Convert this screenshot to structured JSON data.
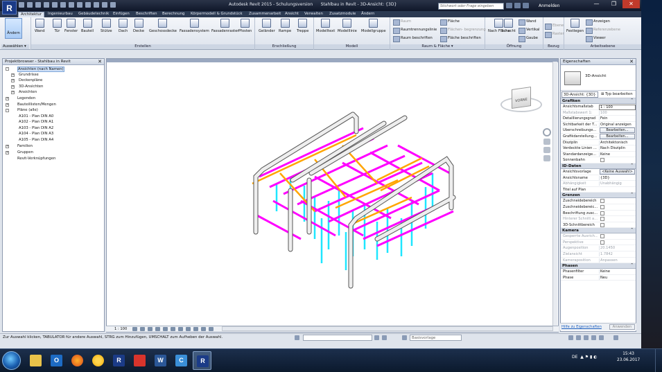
{
  "window": {
    "app_title": "Autodesk Revit 2015 - Schulungsversion",
    "doc_title": "Stahlbau in Revit - 3D-Ansicht: {3D}",
    "search_placeholder": "Stichwort oder Frage eingeben",
    "login": "Anmelden",
    "min": "—",
    "max": "❐",
    "close": "✕"
  },
  "tabs": [
    "Architektur",
    "Ingenieurbau",
    "Gebäudetechnik",
    "Einfügen",
    "Beschriften",
    "Berechnung",
    "Körpermodell & Grundstück",
    "Zusammenarbeit",
    "Ansicht",
    "Verwalten",
    "Zusatzmodule",
    "Ändern"
  ],
  "ribbon": {
    "select": {
      "button": "Ändern",
      "label": "Auswählen ▾"
    },
    "erstellen": {
      "label": "Erstellen",
      "buttons": [
        "Wand",
        "Tür",
        "Fenster",
        "Bauteil",
        "Stütze",
        "Dach",
        "Decke",
        "Geschossdecke",
        "Fassadensystem",
        "Fassadenraster",
        "Pfosten"
      ]
    },
    "erschliessung": {
      "label": "Erschließung",
      "buttons": [
        "Geländer",
        "Rampe",
        "Treppe"
      ]
    },
    "modell": {
      "label": "Modell",
      "buttons": [
        "Modelltext",
        "Modelllinie",
        "Modellgruppe"
      ]
    },
    "raum": {
      "label": "Raum & Fläche ▾",
      "items": [
        "Raum",
        "Raumtrennungslinie",
        "Raum beschriften",
        "Fläche",
        "Flächen- begrenzung",
        "Fläche beschriften"
      ]
    },
    "oeffnung": {
      "label": "Öffnung",
      "buttons": [
        "Nach Fläche",
        "Schacht"
      ],
      "small": [
        "Wand",
        "Vertikal",
        "Gaube"
      ]
    },
    "bezug": {
      "label": "Bezug",
      "small": [
        "Ebene",
        "Raster"
      ]
    },
    "arbeitsebene": {
      "label": "Arbeitsebene",
      "button": "Festlegen",
      "small": [
        "Anzeigen",
        "Referenzebene",
        "Viewer"
      ]
    }
  },
  "browser": {
    "title": "Projektbrowser - Stahlbau in Revit",
    "close": "✕",
    "root": "Ansichten (nach Namen)",
    "views": [
      "Grundrisse",
      "Deckenpläne",
      "3D-Ansichten",
      "Ansichten"
    ],
    "legends": "Legenden",
    "schedules": "Bauteillisten/Mengen",
    "sheets_root": "Pläne (alle)",
    "sheets": [
      "A101 - Plan DIN A0",
      "A102 - Plan DIN A1",
      "A103 - Plan DIN A2",
      "A104 - Plan DIN A3",
      "A105 - Plan DIN A4"
    ],
    "families": "Familien",
    "groups": "Gruppen",
    "links": "Revit-Verknüpfungen"
  },
  "viewcube": {
    "face": "VORNE"
  },
  "viewbar": {
    "scale": "1 : 100"
  },
  "properties": {
    "title": "Eigenschaften",
    "close": "✕",
    "type_name": "3D-Ansicht",
    "type_select": "3D-Ansicht: {3D}",
    "edit_type": "Typ bearbeiten",
    "groups": {
      "grafiken": "Grafiken",
      "identitaet": "ID-Daten",
      "grenzen": "Grenzen",
      "kamera": "Kamera",
      "phasen": "Phasen"
    },
    "grafiken": [
      {
        "k": "Ansichtsmaßstab",
        "v": "1 : 100"
      },
      {
        "k": "Maßstabswert 1:",
        "v": "100"
      },
      {
        "k": "Detaillierungsgrad",
        "v": "Fein"
      },
      {
        "k": "Sichtbarkeit der T...",
        "v": "Original anzeigen"
      },
      {
        "k": "Überschreibunge...",
        "v": "Bearbeiten..."
      },
      {
        "k": "Grafikdarstellung...",
        "v": "Bearbeiten..."
      },
      {
        "k": "Disziplin",
        "v": "Architektonisch"
      },
      {
        "k": "Verdeckte Linien ...",
        "v": "Nach Disziplin"
      },
      {
        "k": "Standardanzeige...",
        "v": "Keine"
      },
      {
        "k": "Sonnenbahn",
        "v": ""
      }
    ],
    "iddaten": [
      {
        "k": "Ansichtsvorlage",
        "v": "<Keine Auswahl>"
      },
      {
        "k": "Ansichtsname",
        "v": "{3D}"
      },
      {
        "k": "Abhängigkeit",
        "v": "Unabhängig"
      },
      {
        "k": "Titel auf Plan",
        "v": ""
      }
    ],
    "grenzen": [
      {
        "k": "Zuschneidebereich",
        "v": ""
      },
      {
        "k": "Zuschneidebereic...",
        "v": ""
      },
      {
        "k": "Beschriftung zusc...",
        "v": ""
      },
      {
        "k": "Hinterer Schnitt a...",
        "v": ""
      },
      {
        "k": "3D-Schnittbereich",
        "v": ""
      }
    ],
    "kamera": [
      {
        "k": "Gesperrte Ausrich...",
        "v": ""
      },
      {
        "k": "Perspektive",
        "v": ""
      },
      {
        "k": "Augenposition",
        "v": "20.1450"
      },
      {
        "k": "Zielansicht",
        "v": "1.7842"
      },
      {
        "k": "Kameraposition",
        "v": "Anpassen"
      }
    ],
    "phasen": [
      {
        "k": "Phasenfilter",
        "v": "Keine"
      },
      {
        "k": "Phase",
        "v": "Neu"
      }
    ],
    "help_link": "Hilfe zu Eigenschaften",
    "apply": "Anwenden"
  },
  "status": {
    "message": "Zur Auswahl klicken, TABULATOR für andere Auswahl, STRG zum Hinzufügen, UMSCHALT zum Aufheben der Auswahl.",
    "model_placeholder": "Basisvorlage"
  },
  "taskbar": {
    "lang": "DE",
    "time": "15:43",
    "date": "23.06.2017",
    "apps": [
      "explorer-icon",
      "outlook-icon",
      "firefox-icon",
      "chrome-icon",
      "revit-viewer-icon",
      "wps-icon",
      "word-icon",
      "citrix-icon",
      "revit-icon"
    ]
  },
  "colors": {
    "beam_magenta": "#ff00ff",
    "beam_orange": "#ffa500",
    "column_cyan": "#1ee6ff",
    "pipe_gray": "#e8e8e8",
    "accent": "#1b3b87"
  }
}
